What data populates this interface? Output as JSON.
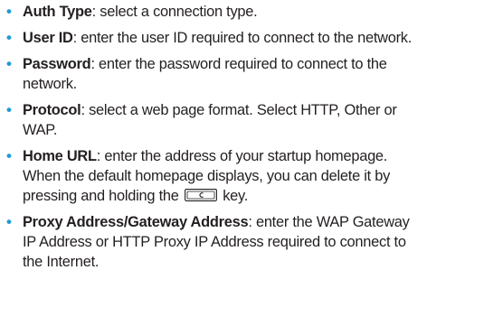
{
  "items": [
    {
      "term": "Auth Type",
      "lines": [
        ": select a connection type."
      ]
    },
    {
      "term": "User ID",
      "lines": [
        ": enter the user ID required to connect to the network."
      ]
    },
    {
      "term": "Password",
      "lines": [
        ": enter the password required to connect to the",
        "network."
      ]
    },
    {
      "term": "Protocol",
      "lines": [
        ": select a web page format. Select HTTP, Other or",
        "WAP."
      ]
    },
    {
      "term": "Home URL",
      "lines": [
        ": enter the address of your startup homepage.",
        "When the default homepage displays, you can delete it by",
        "pressing and holding the",
        "key."
      ],
      "key_icon": "c-key-icon"
    },
    {
      "term": "Proxy Address/Gateway Address",
      "lines": [
        ": enter the WAP Gateway",
        "IP Address or HTTP Proxy IP Address required to connect to",
        "the Internet."
      ]
    }
  ],
  "colors": {
    "bullet": "#1e9ad6",
    "text": "#231f20"
  }
}
